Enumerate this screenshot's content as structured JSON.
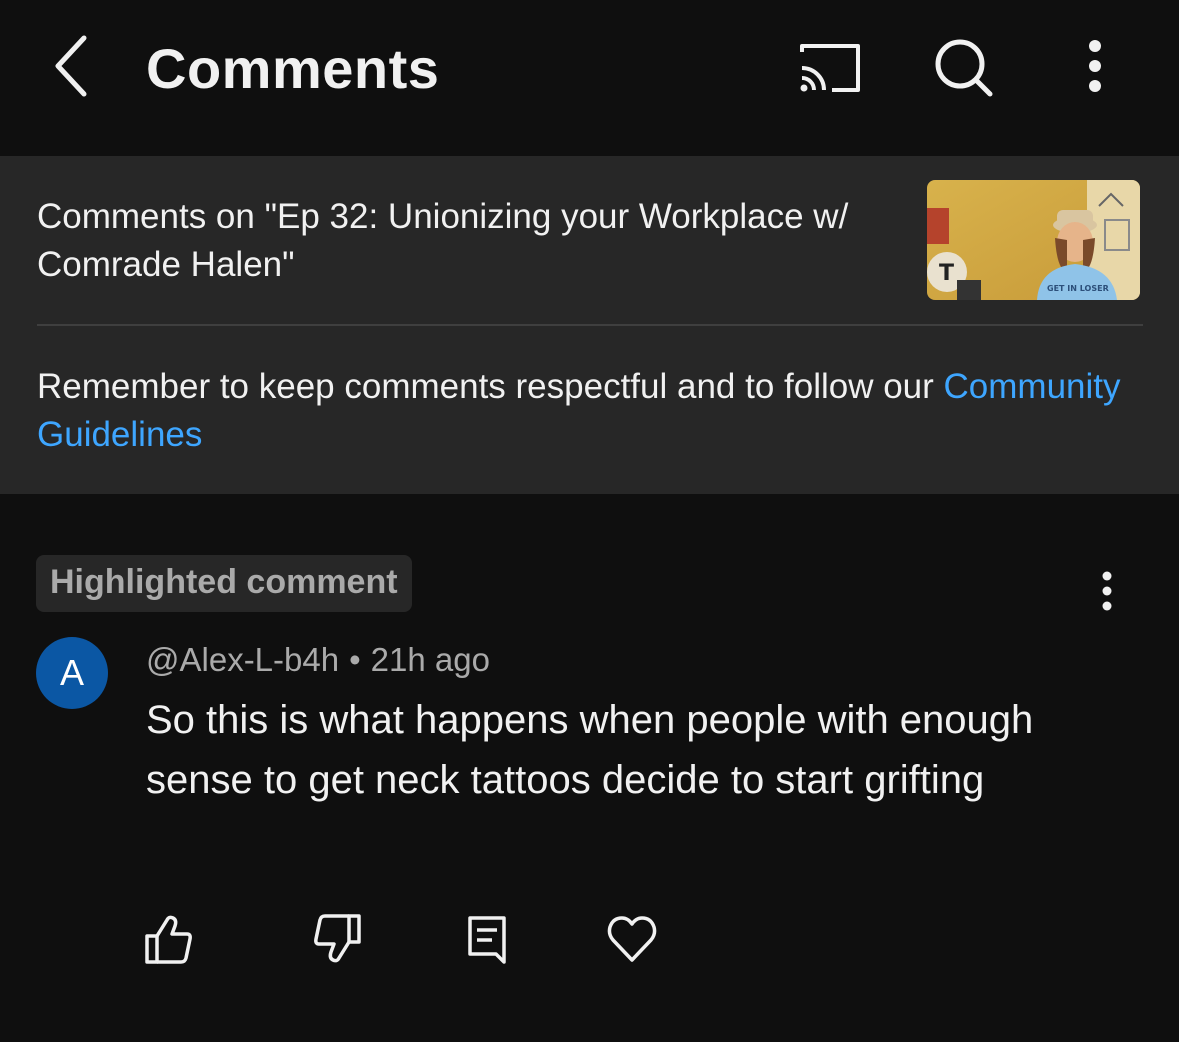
{
  "header": {
    "title": "Comments",
    "icons": [
      "back-arrow-icon",
      "cast-icon",
      "search-icon",
      "more-vertical-icon"
    ]
  },
  "video": {
    "comments_on_title": "Comments on \"Ep 32: Unionizing your Workplace w/ Comrade Halen\"",
    "thumbnail_icon": "video-thumbnail",
    "thumbnail_text": "GET IN LOSER"
  },
  "notice": {
    "text": "Remember to keep comments respectful and to follow our ",
    "link_label": "Community Guidelines"
  },
  "comment": {
    "badge": "Highlighted comment",
    "avatar_letter": "A",
    "author": "@Alex-L-b4h",
    "separator": "•",
    "time": "21h ago",
    "text": "So this is what happens when people with enough sense to get neck tattoos decide to start grifting",
    "actions": [
      "like-icon",
      "dislike-icon",
      "reply-icon",
      "heart-icon"
    ]
  },
  "colors": {
    "background": "#0f0f0f",
    "panel": "#272727",
    "link": "#3ea6ff",
    "avatar": "#0b57a4",
    "secondary_text": "#aaaaaa"
  }
}
